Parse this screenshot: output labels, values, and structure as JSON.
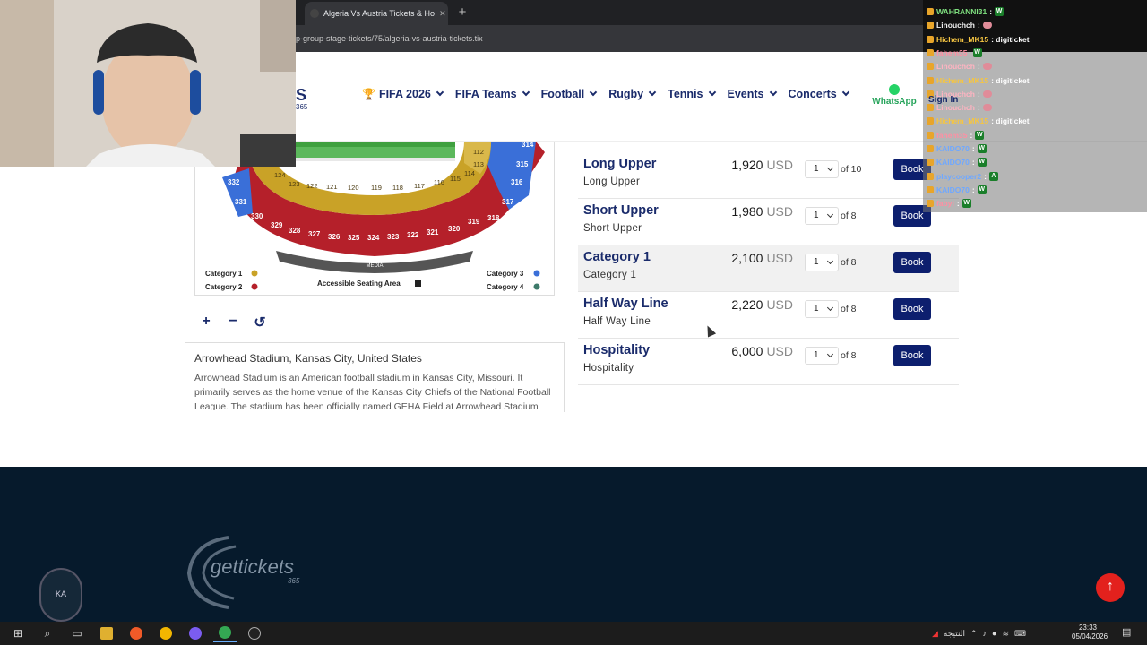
{
  "browser": {
    "tab_title": "Algeria Vs Austria Tickets & Ho",
    "url": "p-group-stage-tickets/75/algeria-vs-austria-tickets.tix"
  },
  "site": {
    "logo_fragment": "S",
    "logo_sub": "365",
    "nav": [
      {
        "label": "FIFA 2026",
        "icon": "trophy-icon"
      },
      {
        "label": "FIFA Teams"
      },
      {
        "label": "Football"
      },
      {
        "label": "Rugby"
      },
      {
        "label": "Tennis"
      },
      {
        "label": "Events"
      },
      {
        "label": "Concerts"
      }
    ],
    "whatsapp_label": "WhatsApp",
    "signin_label": "Sign In"
  },
  "map": {
    "legend": {
      "cat1": "Category 1",
      "cat2": "Category 2",
      "cat3": "Category 3",
      "cat4": "Category 4",
      "accessible": "Accessible  Seating  Area"
    },
    "media_label": "MEDIA",
    "sections_upper": [
      "332",
      "331",
      "330",
      "329",
      "328",
      "327",
      "326",
      "325",
      "324",
      "323",
      "322",
      "321",
      "320",
      "319",
      "318",
      "317",
      "316",
      "315",
      "314"
    ],
    "sections_lower": [
      "124",
      "123",
      "122",
      "121",
      "120",
      "119",
      "118",
      "117",
      "116",
      "115",
      "114",
      "113",
      "112"
    ],
    "tools": {
      "zoom_in": "+",
      "zoom_out": "−",
      "reset": "↺"
    }
  },
  "stadium": {
    "title": "Arrowhead Stadium, Kansas City, United States",
    "description": "Arrowhead Stadium is an American football stadium in Kansas City, Missouri. It primarily serves as the home venue of the Kansas City Chiefs of the National Football League. The stadium has been officially named GEHA Field at Arrowhead Stadium"
  },
  "tickets": [
    {
      "name": "Long Upper",
      "sub": "Long Upper",
      "price": "1,920",
      "currency": "USD",
      "qty": "1",
      "of": "of 10",
      "book": "Book"
    },
    {
      "name": "Short Upper",
      "sub": "Short Upper",
      "price": "1,980",
      "currency": "USD",
      "qty": "1",
      "of": "of 8",
      "book": "Book"
    },
    {
      "name": "Category 1",
      "sub": "Category 1",
      "price": "2,100",
      "currency": "USD",
      "qty": "1",
      "of": "of 8",
      "book": "Book"
    },
    {
      "name": "Half Way Line",
      "sub": "Half Way Line",
      "price": "2,220",
      "currency": "USD",
      "qty": "1",
      "of": "of 8",
      "book": "Book"
    },
    {
      "name": "Hospitality",
      "sub": "Hospitality",
      "price": "6,000",
      "currency": "USD",
      "qty": "1",
      "of": "of 8",
      "book": "Book"
    }
  ],
  "footer": {
    "brand": "gettickets",
    "brand_sub": "365",
    "back_to_top": "↑",
    "avatar_text": "KA"
  },
  "chat": [
    {
      "user": "WAHRANNI31",
      "msg": ": ",
      "badge": "W",
      "color": "#7fe07f"
    },
    {
      "user": "Linouchch",
      "msg": ": ",
      "badge": "pill",
      "color": "#f0f0f0"
    },
    {
      "user": "Hichem_MK15",
      "msg": ": digiticket",
      "badge": "",
      "color": "#f5c542"
    },
    {
      "user": "fahem35",
      "msg": "",
      "badge": "W",
      "color": "#ff8fa3"
    },
    {
      "user": "Linouchch",
      "msg": ": ",
      "badge": "pill",
      "color": "#ffb3c1"
    },
    {
      "user": "Hichem_MK15",
      "msg": ": digiticket",
      "badge": "",
      "color": "#f5c542"
    },
    {
      "user": "Linouchch",
      "msg": ": ",
      "badge": "pill",
      "color": "#ffb3c1"
    },
    {
      "user": "Linouchch",
      "msg": ": ",
      "badge": "pill",
      "color": "#ffb3c1"
    },
    {
      "user": "Hichem_MK15",
      "msg": ": digiticket",
      "badge": "",
      "color": "#f5c542"
    },
    {
      "user": "fahem35",
      "msg": ": ",
      "badge": "W",
      "color": "#ff8fa3"
    },
    {
      "user": "KAIDO70",
      "msg": ": ",
      "badge": "W",
      "color": "#6fa8ff"
    },
    {
      "user": "KAIDO70",
      "msg": ": ",
      "badge": "W",
      "color": "#6fa8ff"
    },
    {
      "user": "playcooper2",
      "msg": ": ",
      "badge": "A",
      "color": "#6fa8ff"
    },
    {
      "user": "KAIDO70",
      "msg": ": ",
      "badge": "W",
      "color": "#6fa8ff"
    },
    {
      "user": "fabyi",
      "msg": ": ",
      "badge": "W",
      "color": "#ff8fa3"
    }
  ],
  "taskbar": {
    "tray_text": "النتيجة",
    "time": "23:33",
    "date": "05/04/2026"
  },
  "colors": {
    "navy": "#1a2b6b",
    "book_button": "#0d1f6e",
    "footer_bg": "#061a2c",
    "back_to_top": "#e3211d",
    "category1": "#c9a227",
    "category2": "#b5202a",
    "category3": "#3a6fd8",
    "category4": "#3d7a6a"
  }
}
